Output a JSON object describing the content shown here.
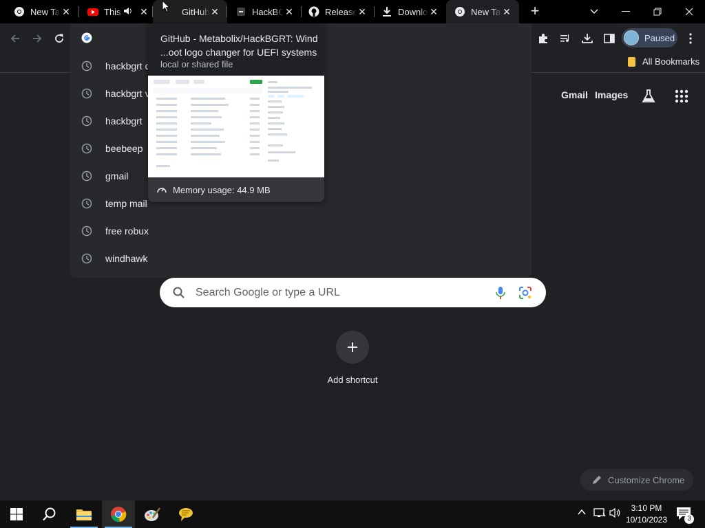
{
  "tabs": [
    {
      "title": "New Tab",
      "icon": "chrome-icon"
    },
    {
      "title": "This",
      "icon": "youtube-icon",
      "audio": "speaker-icon"
    },
    {
      "title": "GitHub",
      "icon": "none"
    },
    {
      "title": "HackBGRT",
      "icon": "minus-icon"
    },
    {
      "title": "Releases",
      "icon": "github-icon"
    },
    {
      "title": "Downloads",
      "icon": "download-icon"
    },
    {
      "title": "New Tab",
      "icon": "chrome-icon"
    }
  ],
  "profile": {
    "label": "Paused"
  },
  "bookmarks_bar": {
    "all_bookmarks": "All Bookmarks"
  },
  "omnibox": {
    "suggestions": [
      "hackbgrt d",
      "hackbgrt v",
      "hackbgrt",
      "beebeep",
      "gmail",
      "temp mail",
      "free robux",
      "windhawk"
    ]
  },
  "hover_card": {
    "title": "GitHub - Metabolix/HackBGRT: Wind ...oot logo changer for UEFI systems",
    "subtitle": "local or shared file",
    "memory": "Memory usage: 44.9 MB"
  },
  "google_links": {
    "gmail": "Gmail",
    "images": "Images"
  },
  "search": {
    "placeholder": "Search Google or type a URL"
  },
  "shortcut": {
    "label": "Add shortcut"
  },
  "customize": {
    "label": "Customize Chrome"
  },
  "taskbar": {
    "time": "3:10 PM",
    "date": "10/10/2023",
    "notifications": "3"
  },
  "colors": {
    "background": "#202124",
    "tabstrip": "#000000",
    "accent": "#8ab4f8"
  }
}
